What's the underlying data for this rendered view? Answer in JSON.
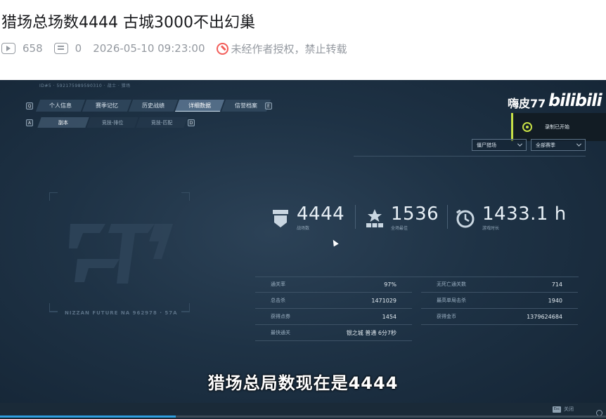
{
  "post": {
    "title": "猎场总场数4444 古城3000不出幻巢",
    "views": "658",
    "comments": "0",
    "datetime": "2026-05-10 09:23:00",
    "copyright": "未经作者授权，禁止转载"
  },
  "video": {
    "top_text": "ID#5 · 592175989590310 · 战士 · 猎场",
    "tabs": [
      {
        "label": "个人信息",
        "active": false
      },
      {
        "label": "赛季记忆",
        "active": false
      },
      {
        "label": "历史战绩",
        "active": false
      },
      {
        "label": "详细数据",
        "active": true
      },
      {
        "label": "信誉档案",
        "active": false
      }
    ],
    "tab_left_key": "Q",
    "tab_right_key": "E",
    "subtabs": [
      {
        "label": "副本",
        "active": true
      },
      {
        "label": "竞技-排位",
        "active": false
      },
      {
        "label": "竞技-匹配",
        "active": false
      }
    ],
    "subtab_left_key": "A",
    "subtab_right_key": "D",
    "streamer_name": "嗨皮77",
    "logo_text": "bilibili",
    "record_toast": "录制已开始",
    "mode_select": "僵尸猎场",
    "season_select": "全部赛季",
    "emblem_caption": "NIZZAN FUTURE NA 962978 · 57A",
    "big_stats": [
      {
        "value": "4444",
        "label": "战场数",
        "icon": "shield-icon"
      },
      {
        "value": "1536",
        "label": "全场最佳",
        "icon": "star-podium-icon"
      },
      {
        "value": "1433.1 h",
        "label": "游戏时长",
        "icon": "clock-icon"
      }
    ],
    "stats_left": [
      {
        "key": "通关率",
        "value": "97%"
      },
      {
        "key": "总击杀",
        "value": "1471029"
      },
      {
        "key": "获得点券",
        "value": "1454"
      },
      {
        "key": "最快通关",
        "value": "银之城 普通 6分7秒"
      }
    ],
    "stats_right": [
      {
        "key": "无死亡通关数",
        "value": "714"
      },
      {
        "key": "最高单局击杀",
        "value": "1940"
      },
      {
        "key": "获得金币",
        "value": "1379624684"
      }
    ],
    "subtitle": "猎场总局数现在是4444",
    "close_hint_key": "Esc",
    "close_hint": "关闭",
    "progress_fraction": 0.29
  }
}
